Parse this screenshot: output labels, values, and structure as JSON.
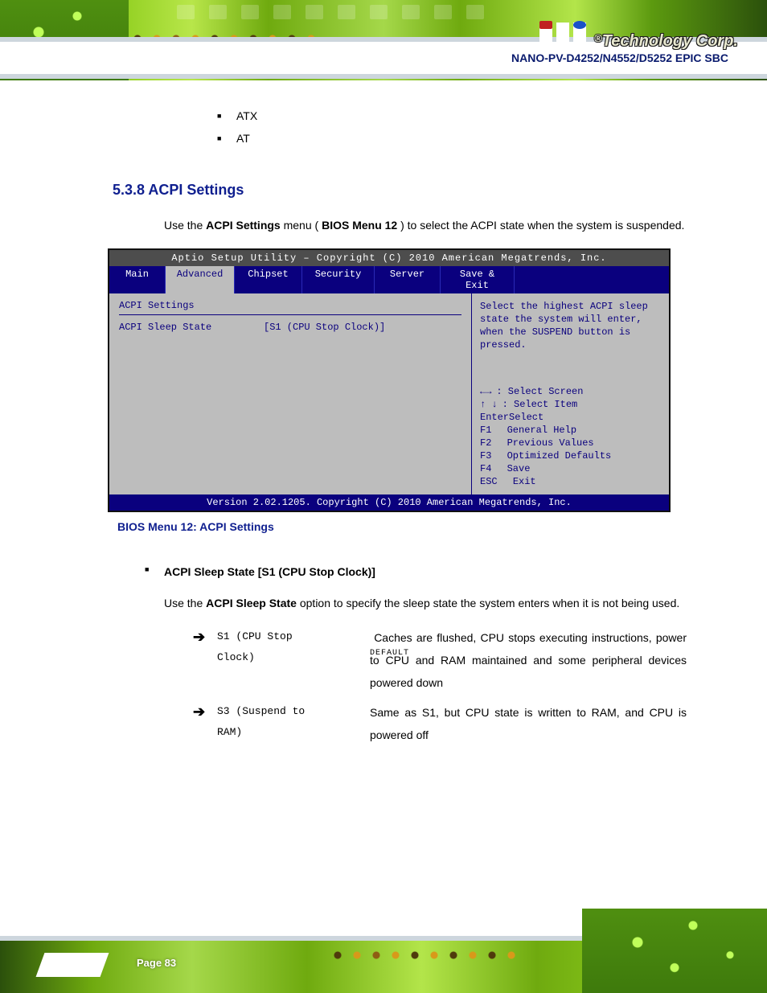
{
  "brand": {
    "r": "®",
    "name": "Technology Corp."
  },
  "doc_title": "NANO-PV-D4252/N4552/D5252 EPIC SBC",
  "bullets_top": {
    "a": "ATX",
    "b": "AT"
  },
  "section": {
    "number": "5.3.8",
    "title": "ACPI Settings"
  },
  "para1": {
    "pre": "Use the ",
    "menu": "ACPI Settings",
    "mid": " menu (",
    "ref": "BIOS Menu 12",
    "post": ") to select the ACPI state when the system is suspended."
  },
  "bios": {
    "title": "Aptio Setup Utility – Copyright (C) 2010 American Megatrends, Inc.",
    "tabs": [
      "Main",
      "Advanced",
      "Chipset",
      "Security",
      "Server",
      "Save & Exit",
      ""
    ],
    "left_head": "ACPI Settings",
    "setting_key": "ACPI Sleep State",
    "setting_val": "[S1 (CPU Stop Clock)]",
    "help": "Select the highest ACPI sleep state the system will enter, when the SUSPEND button is pressed.",
    "keys": {
      "k1": {
        "sym": "←→",
        "txt": ": Select Screen"
      },
      "k2": {
        "sym": "↑ ↓",
        "txt": ": Select Item"
      },
      "k3": {
        "sym": "EnterSelect",
        "txt": ""
      },
      "k4": {
        "sym": "F1",
        "txt": "General Help"
      },
      "k5": {
        "sym": "F2",
        "txt": "Previous Values"
      },
      "k6": {
        "sym": "F3",
        "txt": "Optimized Defaults"
      },
      "k7": {
        "sym": "F4",
        "txt": "Save"
      },
      "k8": {
        "sym": "ESC",
        "txt": "Exit"
      }
    },
    "footer": "Version 2.02.1205. Copyright (C) 2010 American Megatrends, Inc.",
    "caption": "BIOS Menu 12: ACPI Settings"
  },
  "option": {
    "heading": "ACPI Sleep State [S1 (CPU Stop Clock)]",
    "desc_pre": "Use the ",
    "desc_bold": "ACPI Sleep State",
    "desc_post": " option to specify the sleep state the system enters when it is not being used.",
    "rows": [
      {
        "label_a": "S1 (CPU Stop",
        "label_b": "Clock)",
        "default": "DEFAULT",
        "expl": "Caches are flushed, CPU stops executing instructions, power to CPU and RAM maintained and some peripheral devices powered down"
      },
      {
        "label_a": "S3 (Suspend to",
        "label_b": "RAM)",
        "default": "",
        "expl": "Same as S1, but CPU state is written to RAM, and CPU is powered off"
      }
    ]
  },
  "page": {
    "label": "Page 83",
    "num": ""
  }
}
